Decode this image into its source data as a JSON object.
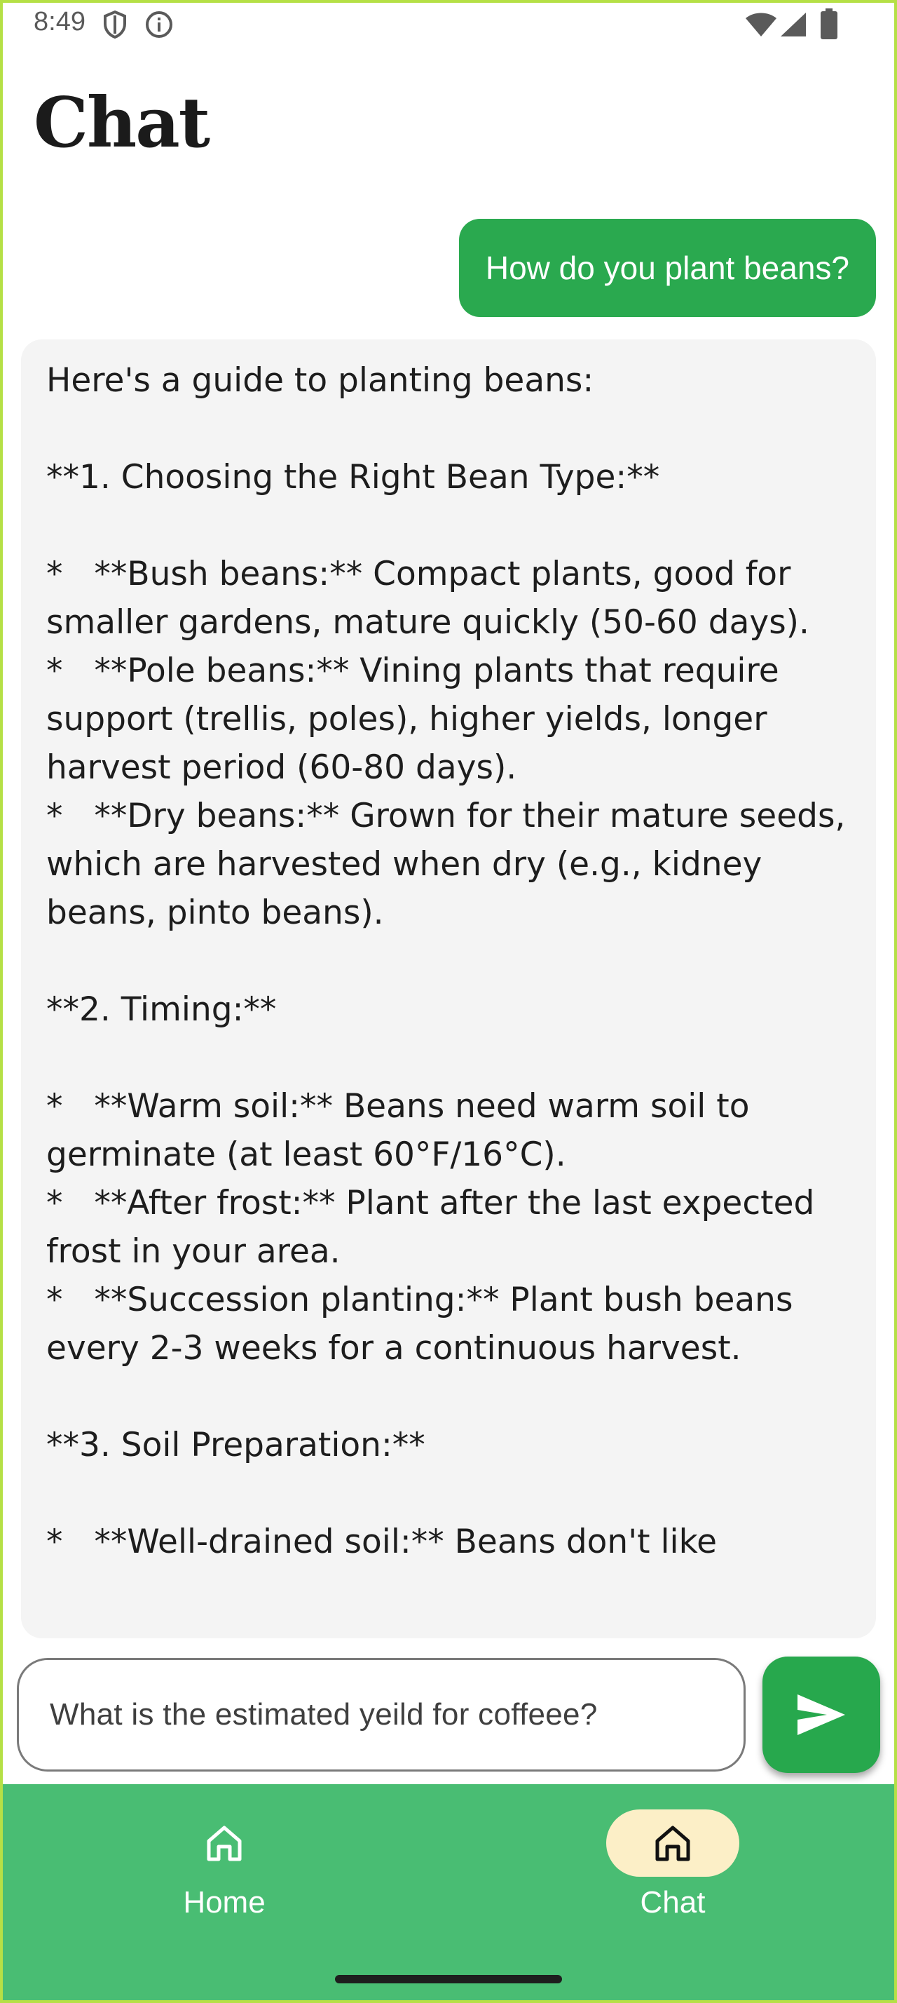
{
  "status_bar": {
    "time": "8:49",
    "left_icons": [
      "shield-icon",
      "info-icon"
    ],
    "right_icons": [
      "wifi-icon",
      "signal-icon",
      "battery-icon"
    ]
  },
  "header": {
    "title": "Chat"
  },
  "conversation": {
    "user_message": "How do you plant beans?",
    "assistant_message": "Here's a guide to planting beans:\n\n**1. Choosing the Right Bean Type:**\n\n*   **Bush beans:** Compact plants, good for smaller gardens, mature quickly (50-60 days).\n*   **Pole beans:** Vining plants that require support (trellis, poles), higher yields, longer harvest period (60-80 days).\n*   **Dry beans:** Grown for their mature seeds, which are harvested when dry (e.g., kidney beans, pinto beans).\n\n**2. Timing:**\n\n*   **Warm soil:** Beans need warm soil to germinate (at least 60°F/16°C).\n*   **After frost:** Plant after the last expected frost in your area.\n*   **Succession planting:** Plant bush beans every 2-3 weeks for a continuous harvest.\n\n**3. Soil Preparation:**\n\n*   **Well-drained soil:** Beans don't like"
  },
  "composer": {
    "input_value": "What is the estimated yeild for coffeee?",
    "send_icon": "send-icon"
  },
  "bottom_nav": {
    "items": [
      {
        "label": "Home",
        "icon": "home-icon",
        "active": false
      },
      {
        "label": "Chat",
        "icon": "home-icon",
        "active": true
      }
    ]
  },
  "colors": {
    "accent": "#2aa94f",
    "nav_background": "#49bd73",
    "active_pill": "#fcefc7",
    "assistant_bubble": "#f4f4f4"
  }
}
